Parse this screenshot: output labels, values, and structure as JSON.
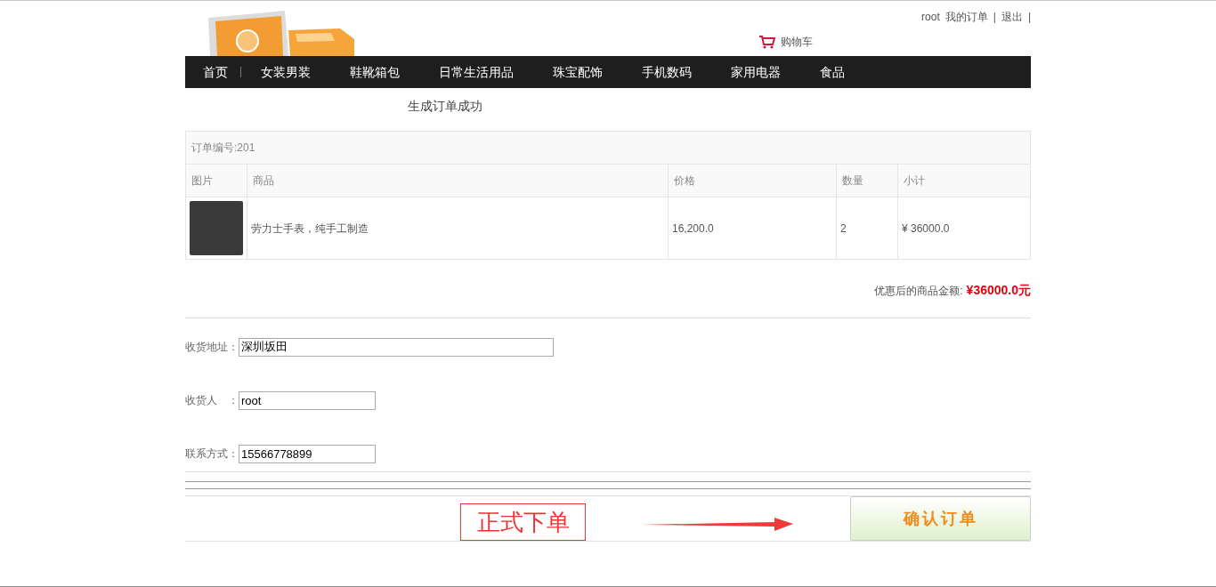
{
  "top_links": [
    {
      "label": "root"
    },
    {
      "label": "我的订单"
    },
    {
      "label": "|"
    },
    {
      "label": "退出"
    },
    {
      "label": "|"
    }
  ],
  "cart": {
    "label": "购物车"
  },
  "nav": [
    {
      "label": "首页"
    },
    {
      "label": "女装男装"
    },
    {
      "label": "鞋靴箱包"
    },
    {
      "label": "日常生活用品"
    },
    {
      "label": "珠宝配饰"
    },
    {
      "label": "手机数码"
    },
    {
      "label": "家用电器"
    },
    {
      "label": "食品"
    }
  ],
  "page_title": "生成订单成功",
  "order": {
    "number_label": "订单编号:201",
    "columns": [
      "图片",
      "商品",
      "价格",
      "数量",
      "小计"
    ],
    "rows": [
      {
        "product": "劳力士手表，纯手工制造",
        "price": "16,200.0",
        "quantity": "2",
        "subtotal": "¥ 36000.0"
      }
    ],
    "total_label": "优惠后的商品金额:",
    "total_value": "¥36000.0元"
  },
  "form": [
    {
      "label": "收货地址：",
      "value": "深圳坂田"
    },
    {
      "label": "收货人　：",
      "value": "root"
    },
    {
      "label": "联系方式：",
      "value": "15566778899"
    }
  ],
  "annotation": "正式下单",
  "confirm_button": "确认订单"
}
